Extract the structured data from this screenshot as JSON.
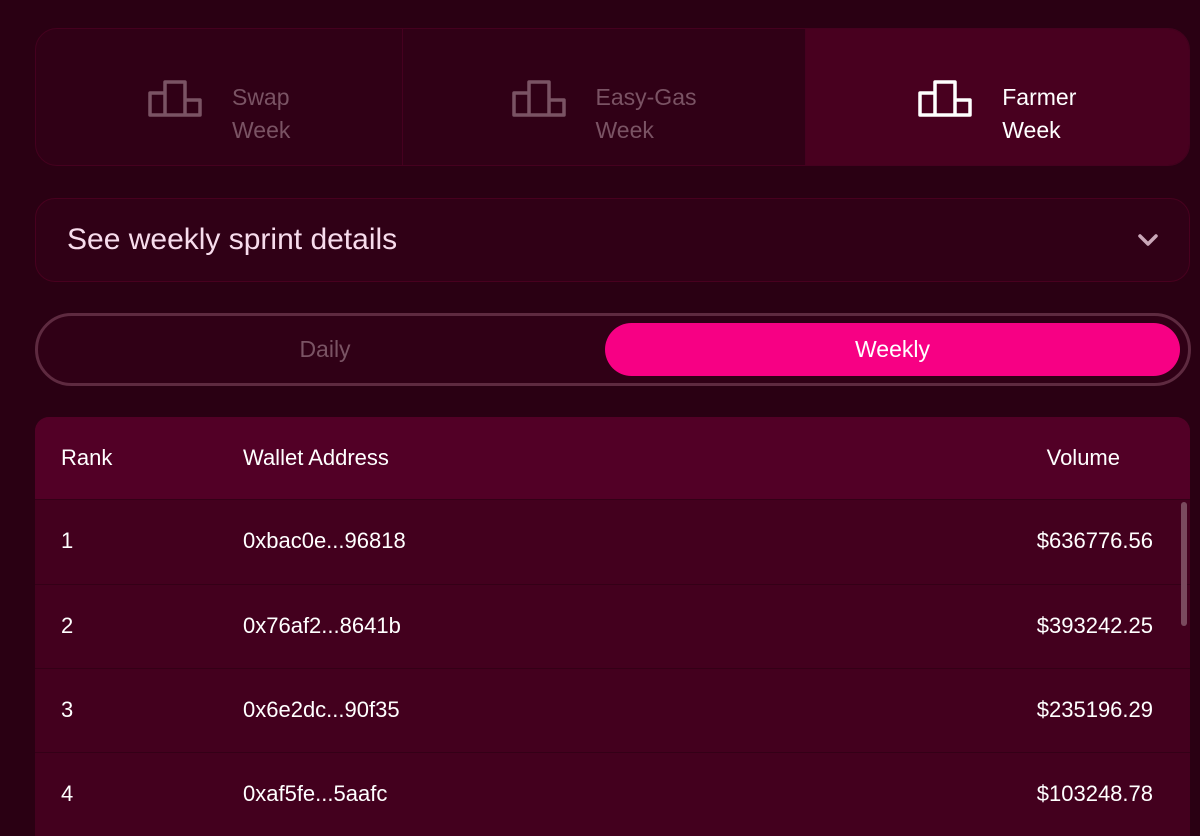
{
  "week_tabs": [
    {
      "line1": "Swap",
      "line2": "Week",
      "icon": "podium-icon",
      "active": false
    },
    {
      "line1": "Easy-Gas",
      "line2": "Week",
      "icon": "podium-icon",
      "active": false
    },
    {
      "line1": "Farmer",
      "line2": "Week",
      "icon": "podium-icon",
      "active": true
    }
  ],
  "details": {
    "title": "See weekly sprint details",
    "icon": "chevron-down-icon"
  },
  "toggle": {
    "daily": "Daily",
    "weekly": "Weekly",
    "selected": "Weekly"
  },
  "table": {
    "headers": {
      "rank": "Rank",
      "wallet": "Wallet Address",
      "volume": "Volume"
    },
    "rows": [
      {
        "rank": "1",
        "wallet": "0xbac0e...96818",
        "volume": "$636776.56"
      },
      {
        "rank": "2",
        "wallet": "0x76af2...8641b",
        "volume": "$393242.25"
      },
      {
        "rank": "3",
        "wallet": "0x6e2dc...90f35",
        "volume": "$235196.29"
      },
      {
        "rank": "4",
        "wallet": "0xaf5fe...5aafc",
        "volume": "$103248.78"
      }
    ]
  },
  "colors": {
    "background": "#2a0013",
    "panel": "#300016",
    "active_tab": "#48001f",
    "accent": "#f70084",
    "table_header": "#520026",
    "table_body": "#43001e",
    "muted_text": "#7a5364"
  }
}
